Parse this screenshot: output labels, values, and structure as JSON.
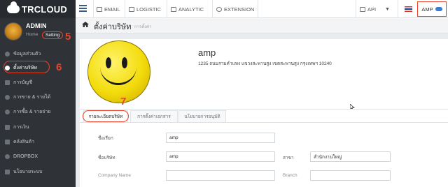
{
  "brand": {
    "logo_text": "TRCLOUD"
  },
  "user": {
    "name": "ADMIN",
    "home_link": "Home",
    "setting_link": "Setting"
  },
  "annotations": {
    "n5": "5",
    "n6": "6",
    "n7": "7"
  },
  "sidebar": {
    "items": [
      {
        "label": "ข้อมูลส่วนตัว",
        "icon": "user-icon"
      },
      {
        "label": "ตั้งค่าบริษัท",
        "icon": "gear-icon",
        "active": true
      },
      {
        "label": "การบัญชี",
        "icon": "book-icon"
      },
      {
        "label": "การขาย & รายได้",
        "icon": "dollar-icon"
      },
      {
        "label": "การซื้อ & รายจ่าย",
        "icon": "cart-icon"
      },
      {
        "label": "การเงิน",
        "icon": "bank-icon"
      },
      {
        "label": "คลังสินค้า",
        "icon": "warehouse-icon"
      },
      {
        "label": "DROPBOX",
        "icon": "dropbox-icon"
      },
      {
        "label": "นโยบายระบบ",
        "icon": "policy-icon"
      }
    ]
  },
  "topbar": {
    "email": "EMAIL",
    "logistic": "LOGISTIC",
    "analytic": "ANALYTIC",
    "extension": "EXTENSION",
    "api": "API",
    "company_button": "AMP"
  },
  "page": {
    "title": "ตั้งค่าบริษัท",
    "subtitle": "การตั้งค่า"
  },
  "profile": {
    "company_name": "amp",
    "address": "1235 ถนนรามคำแหง แขวงสะพานสูง เขตสะพานสูง กรุงเทพฯ 10240"
  },
  "tabs": [
    {
      "label": "รายละเอียดบริษัท",
      "active": true
    },
    {
      "label": "การตั้งค่าเอกสาร"
    },
    {
      "label": "นโยบายการอนุมัติ"
    }
  ],
  "form": {
    "alias_label": "ชื่อเรียก",
    "alias_value": "amp",
    "company_label": "ชื่อบริษัท",
    "company_value": "amp",
    "branch_label_th": "สาขา",
    "branch_value": "สำนักงานใหญ่",
    "company_name_en_label": "Company Name",
    "branch_en_label": "Branch"
  }
}
